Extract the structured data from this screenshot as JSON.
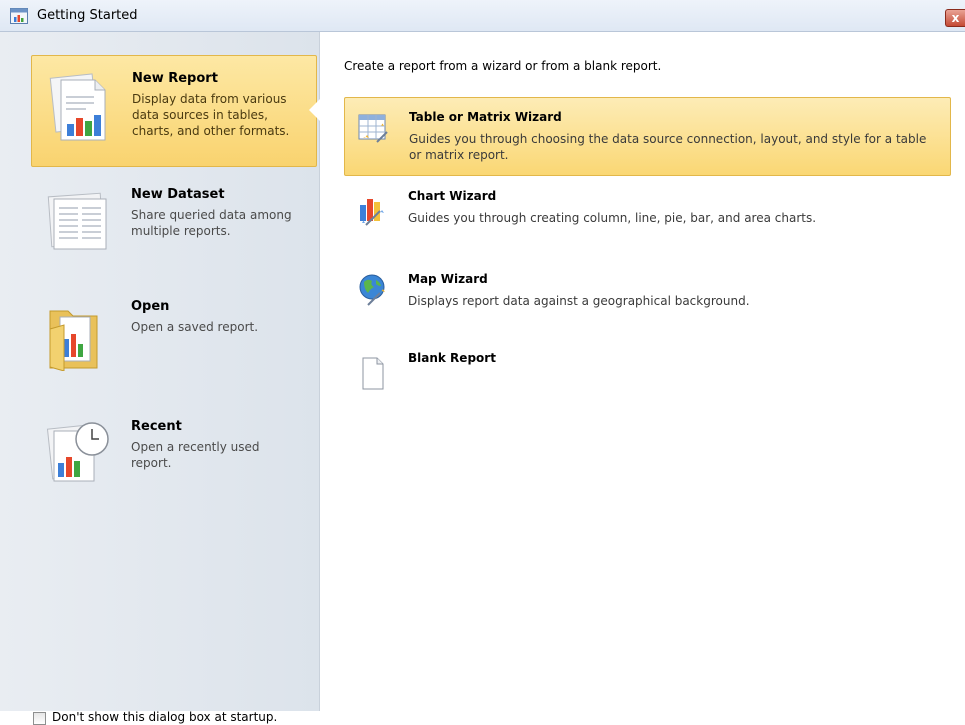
{
  "window": {
    "title": "Getting Started",
    "close_label": "x"
  },
  "sidebar": {
    "items": [
      {
        "title": "New Report",
        "desc": "Display data from various data sources in tables, charts, and other formats.",
        "icon": "report-icon",
        "selected": true
      },
      {
        "title": "New Dataset",
        "desc": "Share queried data among multiple reports.",
        "icon": "dataset-icon",
        "selected": false
      },
      {
        "title": "Open",
        "desc": "Open a saved report.",
        "icon": "folder-icon",
        "selected": false
      },
      {
        "title": "Recent",
        "desc": "Open a recently used report.",
        "icon": "clock-report-icon",
        "selected": false
      }
    ],
    "startup_checkbox": {
      "label": "Don't show this dialog box at startup.",
      "checked": false
    }
  },
  "main": {
    "intro": "Create a report from a wizard or from a blank report.",
    "wizards": [
      {
        "title": "Table or Matrix Wizard",
        "desc": "Guides you through choosing the data source connection, layout, and style for a table or matrix report.",
        "icon": "table-wizard-icon",
        "selected": true
      },
      {
        "title": "Chart Wizard",
        "desc": "Guides you through creating column, line, pie, bar, and area charts.",
        "icon": "chart-wizard-icon",
        "selected": false
      },
      {
        "title": "Map Wizard",
        "desc": "Displays report data against a geographical background.",
        "icon": "map-wizard-icon",
        "selected": false
      },
      {
        "title": "Blank Report",
        "desc": "",
        "icon": "blank-page-icon",
        "selected": false
      }
    ]
  },
  "colors": {
    "selection_fill": "#f9d36f",
    "selection_border": "#e2b74a",
    "sidebar_bg": "#e3e8ee"
  }
}
